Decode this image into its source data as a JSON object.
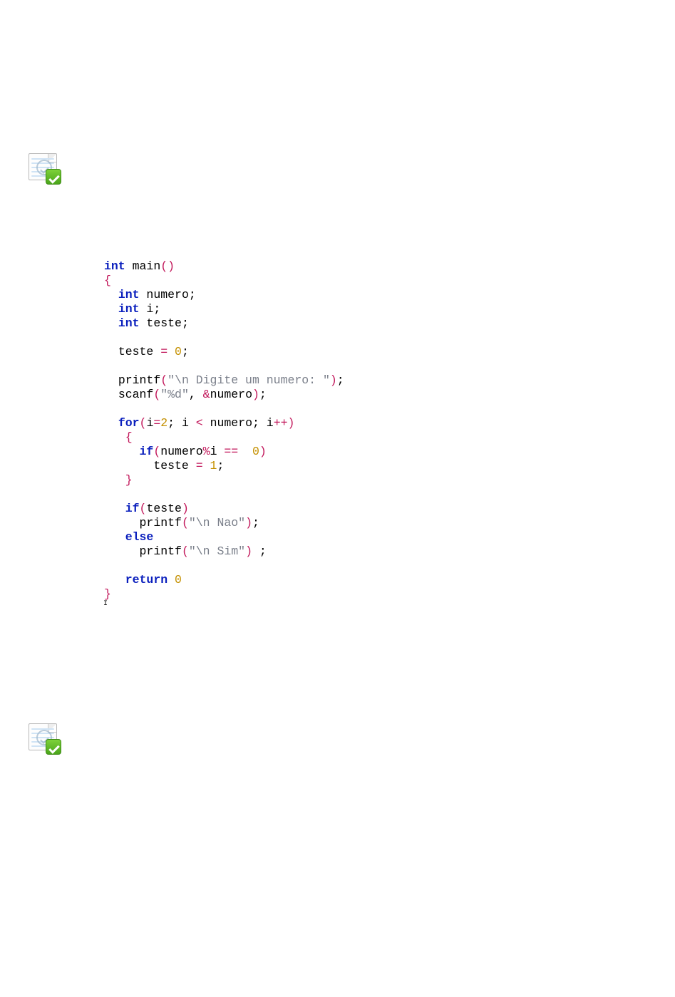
{
  "icons": {
    "top": "doc-verified-icon",
    "bottom": "doc-verified-icon"
  },
  "code": {
    "l1_int": "int",
    "l1_main": " main",
    "l1_p": "()",
    "l2_brace": "{",
    "l3_int": "int",
    "l3_rest": " numero",
    "l3_semi": ";",
    "l4_int": "int",
    "l4_rest": " i",
    "l4_semi": ";",
    "l5_int": "int",
    "l5_rest": " teste",
    "l5_semi": ";",
    "l7_teste": "teste ",
    "l7_eq": "=",
    "l7_sp": " ",
    "l7_zero": "0",
    "l7_semi": ";",
    "l9_printf": "printf",
    "l9_p1": "(",
    "l9_str": "\"\\n Digite um numero: \"",
    "l9_p2": ")",
    "l9_semi": ";",
    "l10_scanf": "scanf",
    "l10_p1": "(",
    "l10_str": "\"%d\"",
    "l10_comma": ", ",
    "l10_amp": "&",
    "l10_num": "numero",
    "l10_p2": ")",
    "l10_semi": ";",
    "l12_for": "for",
    "l12_p1": "(",
    "l12_i": "i",
    "l12_eq": "=",
    "l12_two": "2",
    "l12_semi1": ";",
    "l12_sp1": " i ",
    "l12_lt": "<",
    "l12_sp2": " numero",
    "l12_semi2": ";",
    "l12_sp3": " i",
    "l12_pp": "++",
    "l12_p2": ")",
    "l13_brace": "{",
    "l14_if": "if",
    "l14_p1": "(",
    "l14_num": "numero",
    "l14_mod": "%",
    "l14_i": "i ",
    "l14_eqeq": "==",
    "l14_sp": "  ",
    "l14_zero": "0",
    "l14_p2": ")",
    "l15_teste": "teste ",
    "l15_eq": "=",
    "l15_sp": " ",
    "l15_one": "1",
    "l15_semi": ";",
    "l16_brace": "}",
    "l18_if": "if",
    "l18_p1": "(",
    "l18_teste": "teste",
    "l18_p2": ")",
    "l19_printf": "printf",
    "l19_p1": "(",
    "l19_str": "\"\\n Nao\"",
    "l19_p2": ")",
    "l19_semi": ";",
    "l20_else": "else",
    "l21_printf": "printf",
    "l21_p1": "(",
    "l21_str": "\"\\n Sim\"",
    "l21_p2": ")",
    "l21_sp": " ",
    "l21_semi": ";",
    "l23_return": "return",
    "l23_sp": " ",
    "l23_zero": "0",
    "l24_brace": "}",
    "cursor": "I"
  }
}
